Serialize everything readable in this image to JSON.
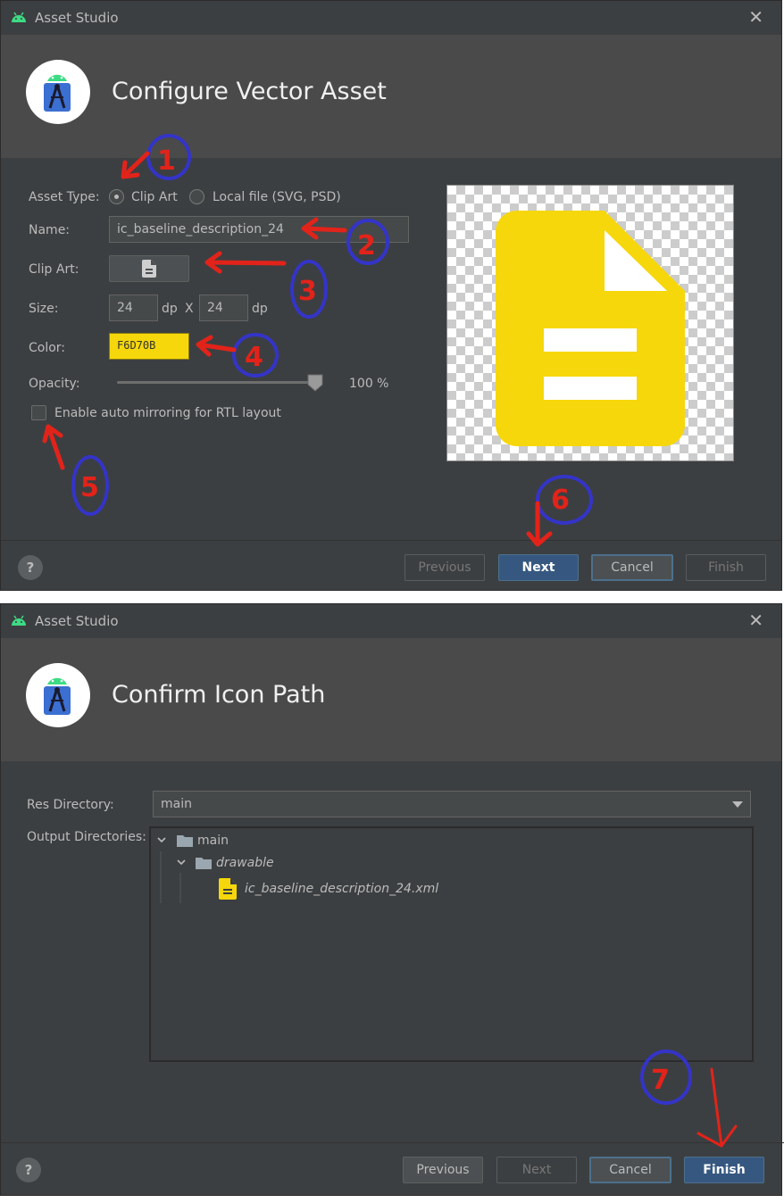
{
  "dialog1": {
    "window_title": "Asset Studio",
    "close_glyph": "✕",
    "heading": "Configure Vector Asset",
    "asset_type": {
      "label": "Asset Type:",
      "options": [
        "Clip Art",
        "Local file (SVG, PSD)"
      ],
      "selected": "Clip Art"
    },
    "name": {
      "label": "Name:",
      "value": "ic_baseline_description_24"
    },
    "clip_art": {
      "label": "Clip Art:",
      "icon": "description-icon"
    },
    "size": {
      "label": "Size:",
      "width": "24",
      "height": "24",
      "unit": "dp",
      "separator": "X"
    },
    "color": {
      "label": "Color:",
      "value": "F6D70B",
      "swatch": "#F6D70B"
    },
    "opacity": {
      "label": "Opacity:",
      "value_text": "100 %",
      "value": 100
    },
    "auto_mirroring": {
      "label": "Enable auto mirroring for RTL layout",
      "checked": false
    },
    "buttons": {
      "help": "?",
      "previous": "Previous",
      "next": "Next",
      "cancel": "Cancel",
      "finish": "Finish"
    }
  },
  "dialog2": {
    "window_title": "Asset Studio",
    "close_glyph": "✕",
    "heading": "Confirm Icon Path",
    "res_directory": {
      "label": "Res Directory:",
      "value": "main"
    },
    "output_directories": {
      "label": "Output Directories:",
      "tree": [
        {
          "name": "main",
          "type": "folder",
          "expanded": true
        },
        {
          "name": "drawable",
          "type": "folder",
          "expanded": true
        },
        {
          "name": "ic_baseline_description_24.xml",
          "type": "file"
        }
      ]
    },
    "buttons": {
      "help": "?",
      "previous": "Previous",
      "next": "Next",
      "cancel": "Cancel",
      "finish": "Finish"
    }
  },
  "annotations": [
    "1",
    "2",
    "3",
    "4",
    "5",
    "6",
    "7"
  ],
  "colors": {
    "dialog_bg": "#3c3f41",
    "banner_bg": "#4a4a4a",
    "accent_blue": "#365880",
    "icon_yellow": "#F6D70B",
    "annotation_red": "#e2231a",
    "annotation_blue": "#3434c8"
  }
}
